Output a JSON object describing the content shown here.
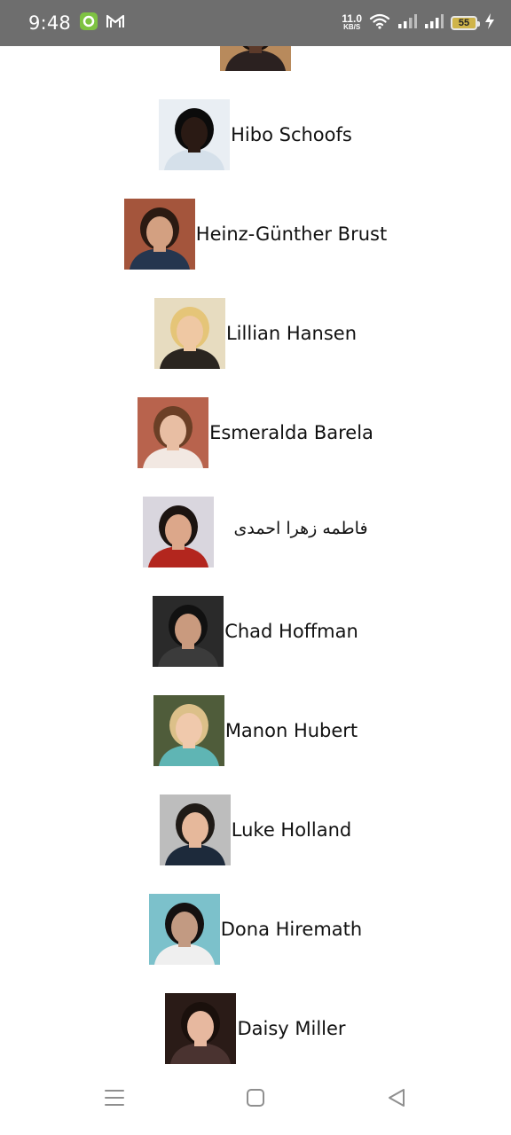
{
  "status_bar": {
    "time": "9:48",
    "net_speed_value": "11.0",
    "net_speed_unit": "KB/S",
    "battery_level": "55",
    "icons": [
      "notification-app-icon",
      "gmail-icon",
      "wifi-icon",
      "signal-icon",
      "signal-icon",
      "battery-icon",
      "charging-icon"
    ]
  },
  "contacts": [
    {
      "name": "",
      "photo_icon": "avatar-photo",
      "bg": "#b88a5c",
      "skin": "#5c3a2a",
      "hair": "#1b120d",
      "shirt": "#2b2120"
    },
    {
      "name": "Hibo Schoofs",
      "photo_icon": "avatar-photo",
      "bg": "#e9eef3",
      "skin": "#2a1a14",
      "hair": "#0b0b0b",
      "shirt": "#d5e0ea"
    },
    {
      "name": "Heinz-Günther Brust",
      "photo_icon": "avatar-photo",
      "bg": "#a4553c",
      "skin": "#d3a081",
      "hair": "#2b1a12",
      "shirt": "#25364f"
    },
    {
      "name": "Lillian Hansen",
      "photo_icon": "avatar-photo",
      "bg": "#e7dcc0",
      "skin": "#efc8a3",
      "hair": "#e5c578",
      "shirt": "#2a2520"
    },
    {
      "name": "Esmeralda Barela",
      "photo_icon": "avatar-photo",
      "bg": "#b8634d",
      "skin": "#e8bea3",
      "hair": "#6b3f26",
      "shirt": "#f2e8e2"
    },
    {
      "name": "فاطمه زهرا احمدی",
      "photo_icon": "avatar-photo",
      "bg": "#d9d6de",
      "skin": "#dca78a",
      "hair": "#1c1411",
      "shirt": "#b3261e",
      "rtl": true
    },
    {
      "name": "Chad Hoffman",
      "photo_icon": "avatar-photo",
      "bg": "#2a2a2a",
      "skin": "#c99a7e",
      "hair": "#111111",
      "shirt": "#3b3b3b"
    },
    {
      "name": "Manon Hubert",
      "photo_icon": "avatar-photo",
      "bg": "#4f5c3a",
      "skin": "#f0c9ac",
      "hair": "#dcc089",
      "shirt": "#5fb5b4"
    },
    {
      "name": "Luke Holland",
      "photo_icon": "avatar-photo",
      "bg": "#bdbdbd",
      "skin": "#e6b89b",
      "hair": "#1f1a16",
      "shirt": "#1d2a3b"
    },
    {
      "name": "Dona Hiremath",
      "photo_icon": "avatar-photo",
      "bg": "#7cc1cb",
      "skin": "#c29a82",
      "hair": "#141010",
      "shirt": "#efefef"
    },
    {
      "name": "Daisy Miller",
      "photo_icon": "avatar-photo",
      "bg": "#2a1b17",
      "skin": "#e7b89f",
      "hair": "#1a100c",
      "shirt": "#4a3330"
    }
  ],
  "nav_bar": {
    "icons": [
      "menu-icon",
      "home-icon",
      "back-icon"
    ]
  }
}
